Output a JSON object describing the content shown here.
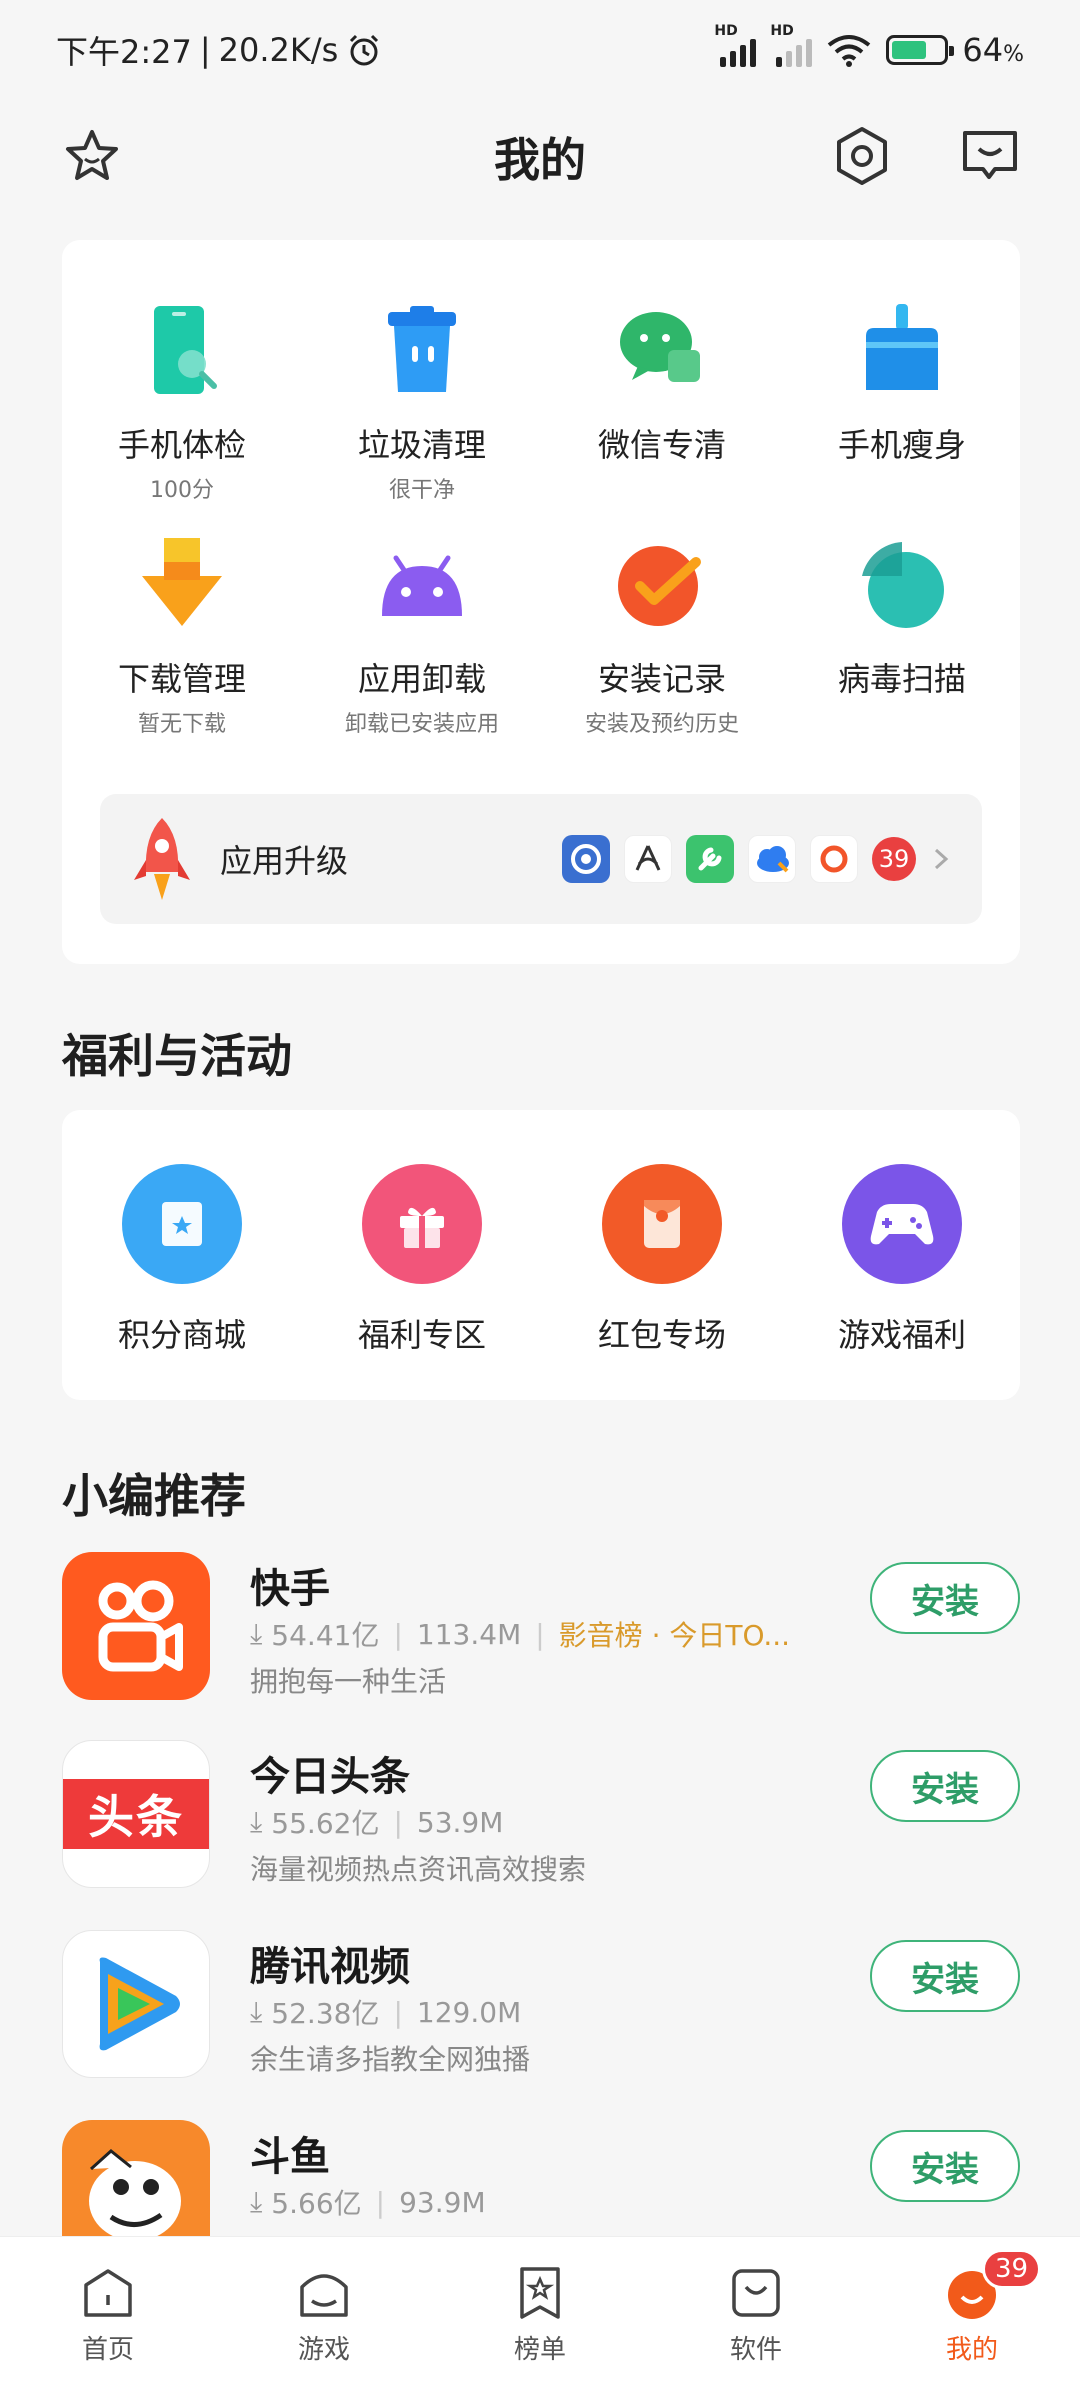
{
  "status": {
    "time": "下午2:27",
    "speed": "20.2K/s",
    "battery": "64",
    "hd": "HD"
  },
  "header": {
    "title": "我的"
  },
  "tools": [
    {
      "label": "手机体检",
      "sub": "100分"
    },
    {
      "label": "垃圾清理",
      "sub": "很干净"
    },
    {
      "label": "微信专清",
      "sub": ""
    },
    {
      "label": "手机瘦身",
      "sub": ""
    },
    {
      "label": "下载管理",
      "sub": "暂无下载"
    },
    {
      "label": "应用卸载",
      "sub": "卸载已安装应用"
    },
    {
      "label": "安装记录",
      "sub": "安装及预约历史"
    },
    {
      "label": "病毒扫描",
      "sub": ""
    }
  ],
  "upgrade": {
    "label": "应用升级",
    "count": "39"
  },
  "welfare": {
    "title": "福利与活动",
    "items": [
      {
        "label": "积分商城",
        "color": "#3aa8f5"
      },
      {
        "label": "福利专区",
        "color": "#f2557a"
      },
      {
        "label": "红包专场",
        "color": "#f25a28"
      },
      {
        "label": "游戏福利",
        "color": "#7b55e8"
      }
    ]
  },
  "recommend": {
    "title": "小编推荐",
    "apps": [
      {
        "name": "快手",
        "downloads": "54.41亿",
        "size": "113.4M",
        "tag": "影音榜 · 今日TO...",
        "desc": "拥抱每一种生活",
        "button": "安装"
      },
      {
        "name": "今日头条",
        "downloads": "55.62亿",
        "size": "53.9M",
        "tag": "",
        "desc": "海量视频热点资讯高效搜索",
        "button": "安装"
      },
      {
        "name": "腾讯视频",
        "downloads": "52.38亿",
        "size": "129.0M",
        "tag": "",
        "desc": "余生请多指教全网独播",
        "button": "安装"
      },
      {
        "name": "斗鱼",
        "downloads": "5.66亿",
        "size": "93.9M",
        "tag": "",
        "desc": "",
        "button": "安装"
      }
    ]
  },
  "toutiao_logo_text": "头条",
  "nav": {
    "items": [
      "首页",
      "游戏",
      "榜单",
      "软件",
      "我的"
    ],
    "badge": "39",
    "active_color": "#f25a1a"
  }
}
